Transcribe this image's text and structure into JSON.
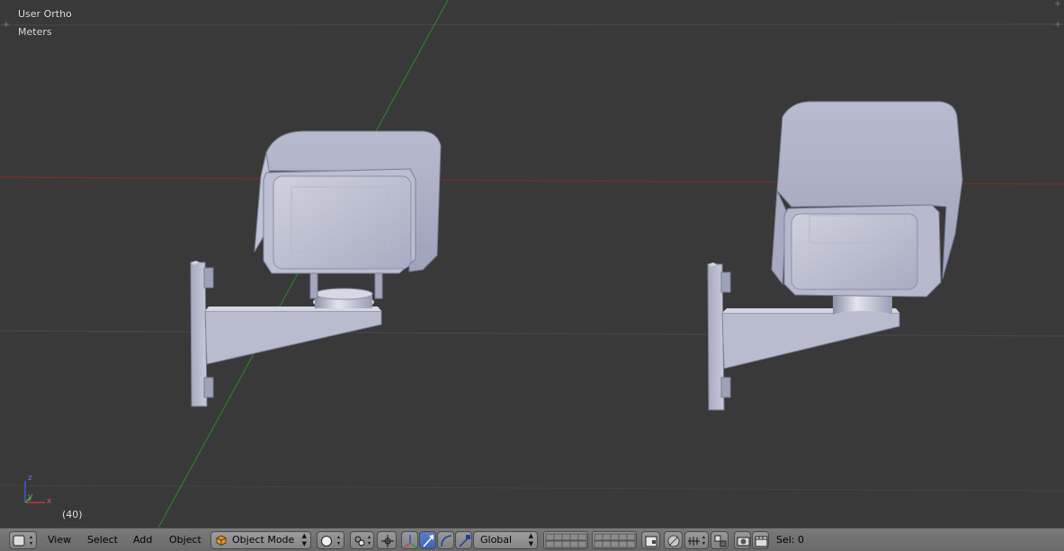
{
  "viewport": {
    "view_name": "User Ortho",
    "units": "Meters",
    "frame": "(40)",
    "axis_labels": {
      "z": "z",
      "y": "y",
      "x": "x"
    },
    "colors": {
      "background": "#393939",
      "x_axis": "#8a1f1f",
      "y_axis": "#1f8a1f",
      "mesh": "#b4b7cc"
    }
  },
  "header": {
    "menu": {
      "view": "View",
      "select": "Select",
      "add": "Add",
      "object": "Object"
    },
    "mode": "Object Mode",
    "orientation": "Global",
    "selection": "Sel: 0",
    "icons": [
      "editor-type-icon",
      "viewport-shading-icon",
      "pivot-point-icon",
      "manipulator-toggle-icon",
      "translate-manipulator-icon",
      "rotate-manipulator-icon",
      "scale-manipulator-icon",
      "layers-grid",
      "lock-camera-icon",
      "proportional-edit-icon",
      "snap-icon",
      "snap-target-icon",
      "render-icon",
      "render-animation-icon"
    ]
  }
}
